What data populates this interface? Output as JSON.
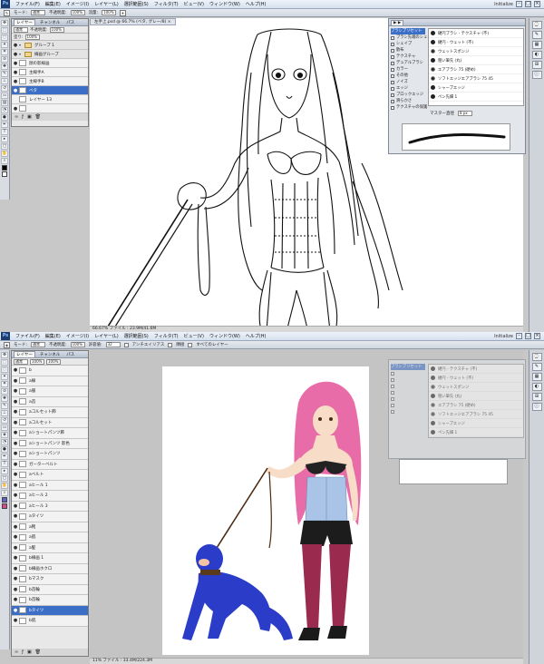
{
  "menu": [
    "ファイル(F)",
    "編集(E)",
    "イメージ(I)",
    "レイヤー(L)",
    "選択範囲(S)",
    "フィルタ(T)",
    "ビュー(V)",
    "ウィンドウ(W)",
    "ヘルプ(H)"
  ],
  "workspace": "Initialize",
  "app_logo": "Ps",
  "top": {
    "options": {
      "mode_label": "モード:",
      "mode_value": "通常",
      "opacity_label": "不透明度:",
      "opacity_value": "100%",
      "flow_label": "流量:",
      "flow_value": "100%"
    },
    "doc_tab": "左手上.psd @ 66.7% (ベタ, グレー/8) ×",
    "layers_tabs": [
      "レイヤー",
      "チャンネル",
      "パス"
    ],
    "blend": "通常",
    "lock_label": "不透明度:",
    "opacity": "100%",
    "fill_label": "塗り:",
    "fill": "100%",
    "layers": [
      {
        "name": "グループ 1",
        "type": "group"
      },
      {
        "name": "線画グループ",
        "type": "group"
      },
      {
        "name": "顔の影線画",
        "type": "layer"
      },
      {
        "name": "主線手A",
        "type": "layer"
      },
      {
        "name": "主線手B",
        "type": "layer"
      },
      {
        "name": "ベタ",
        "type": "layer",
        "selected": true
      },
      {
        "name": "レイヤー 13",
        "type": "layer"
      },
      {
        "name": "",
        "type": "layer"
      }
    ],
    "status": "66.67%    ファイル : 23.9M/41.6M",
    "brush_options": [
      "ブラシプリセット",
      "ブラシ先端のシェイプ",
      "シェイプ",
      "散布",
      "テクスチャ",
      "デュアルブラシ",
      "カラー",
      "その他",
      "ノイズ",
      "エッジ",
      "ブロックエッジ",
      "滑らかさ",
      "テクスチャの保護"
    ],
    "brush_presets": [
      "硬円ブラシ - テクスチャ (不)",
      "硬円 - ウェット (不)",
      "ウェットスポンジ",
      "粗い筆先 (丸)",
      "エアブラシ 75 (硬め)",
      "ソフトエッジエアブラシ 75 45",
      "シャープエッジ",
      "ペン先細 1"
    ],
    "master_diameter_label": "マスター直径",
    "master_diameter": "8 px"
  },
  "bottom": {
    "options": {
      "mode_label": "モード:",
      "mode_value": "通常",
      "opacity_label": "不透明度:",
      "opacity_value": "100%",
      "tolerance_label": "許容値:",
      "tolerance_value": "32",
      "antialias": "アンチエイリアス",
      "contiguous": "隣接",
      "all_layers": "すべてのレイヤー"
    },
    "layers_tabs": [
      "レイヤー",
      "チャンネル",
      "パス"
    ],
    "blend": "通常",
    "opacity": "100%",
    "fill": "100%",
    "layers": [
      "b",
      "a線",
      "a服",
      "a首",
      "aコルセット飾",
      "aコルセット",
      "aショートパンツ飾",
      "aショートパンツ 影色",
      "aショートパンツ",
      "ガーターベルト",
      "aベルト",
      "aヒール 1",
      "aヒール 2",
      "aヒール 3",
      "aタイツ",
      "a靴",
      "a肌",
      "a髪",
      "b線画 1",
      "b線画ホクロ",
      "bマスク",
      "b首輪",
      "b首輪",
      "bタイツ",
      "b肌"
    ],
    "selected_layer": "bタイツ",
    "status": "11%    ファイル : 33.4M/224.3M",
    "brush_presets": [
      "硬円 - テクスチャ (不)",
      "硬円 - ウェット (不)",
      "ウェットスポンジ",
      "粗い筆先 (丸)",
      "エアブラシ 75 (硬め)",
      "ソフトエッジエアブラシ 75 45",
      "シャープエッジ",
      "ペン先細 1"
    ]
  },
  "colors": {
    "hair": "#e86ca8",
    "bodysuit": "#2a3cc8",
    "stockings": "#9a2a4e",
    "corset": "#a9c4e6",
    "selected": "#3b6fc7"
  }
}
